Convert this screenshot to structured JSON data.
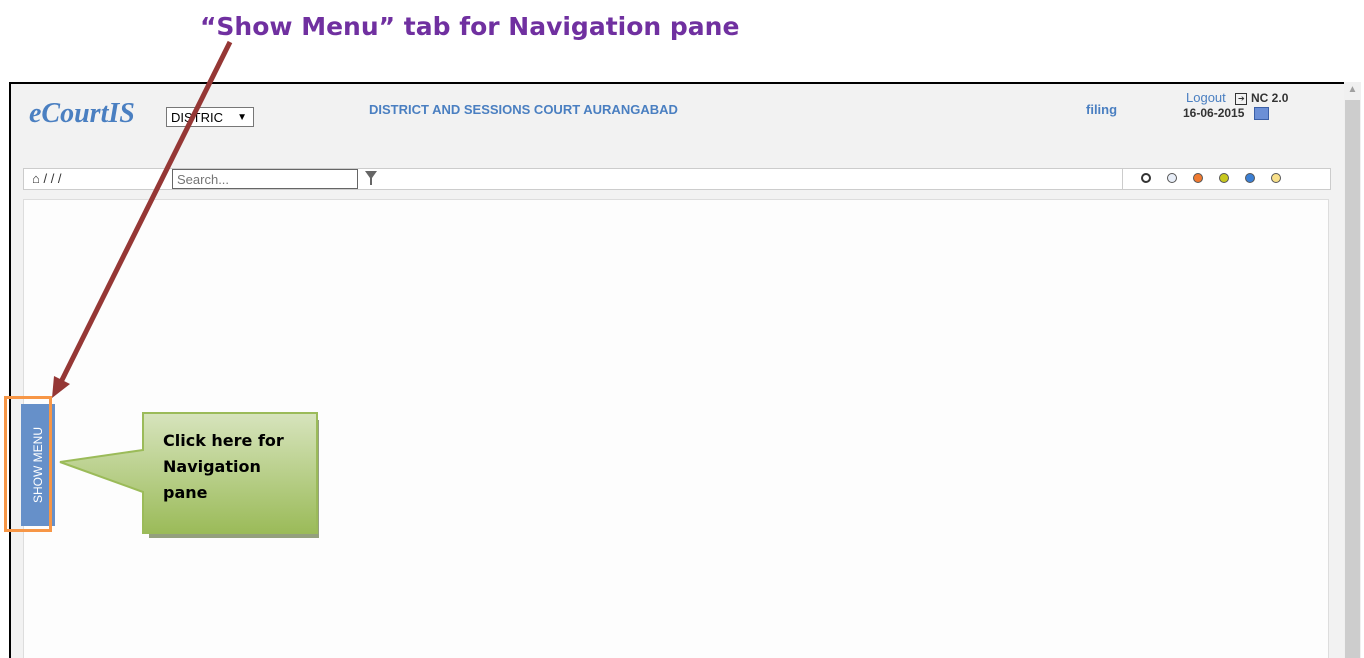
{
  "annotation": {
    "heading": "“Show Menu” tab for Navigation pane",
    "callout_lines": [
      "Click here for",
      "Navigation",
      "pane"
    ],
    "heading_color": "#7030a0",
    "arrow_color": "#953735",
    "highlight_color": "#f79646",
    "callout_color": "#9bbb59"
  },
  "app": {
    "logo": "eCourtIS",
    "district_select": {
      "value": "DISTRIC"
    },
    "court_name": "DISTRICT AND SESSIONS COURT AURANGABAD",
    "menu_link": "filing",
    "logout_label": "Logout",
    "version": "NC 2.0",
    "date": "16-06-2015",
    "breadcrumb": "/ / /",
    "search": {
      "placeholder": "Search..."
    },
    "theme_colors": [
      "#ffffff",
      "#e8eef8",
      "#f07a30",
      "#c8c81e",
      "#3b7fd4",
      "#f8e08a"
    ],
    "show_menu_label": "SHOW MENU",
    "accent_color": "#4a7fc1"
  }
}
